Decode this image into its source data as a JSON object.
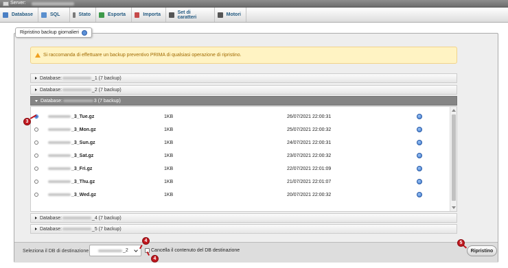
{
  "window": {
    "server_label": "Server:"
  },
  "navbar": {
    "tabs": [
      {
        "label": "Database",
        "icon": "database-icon",
        "color": "#4a7fc4"
      },
      {
        "label": "SQL",
        "icon": "sql-icon",
        "color": "#5a8fce"
      },
      {
        "label": "Stato",
        "icon": "status-icon",
        "color": "#7a7a7a"
      },
      {
        "label": "Esporta",
        "icon": "export-icon",
        "color": "#3e9a4a"
      },
      {
        "label": "Importa",
        "icon": "import-icon",
        "color": "#c64a4a"
      },
      {
        "label": "Set di caratteri",
        "icon": "charset-icon",
        "color": "#555555"
      },
      {
        "label": "Motori",
        "icon": "engines-icon",
        "color": "#555555"
      }
    ]
  },
  "panel": {
    "title": "Ripristino backup giornalieri",
    "notice": "Si raccomanda di effettuare un backup preventivo PRIMA di qualsiasi operazione di ripristino."
  },
  "databases": {
    "prefix": "Database:",
    "rows": [
      {
        "suffix": "_1 (7 backup)"
      },
      {
        "suffix": "_2 (7 backup)"
      },
      {
        "suffix": "3 (7 backup)"
      },
      {
        "suffix": "_4 (7 backup)"
      },
      {
        "suffix": "_5 (7 backup)"
      }
    ]
  },
  "files": [
    {
      "name_suffix": "_3_Tue.gz",
      "size": "1KB",
      "date": "26/07/2021 22:00:31",
      "selected": true
    },
    {
      "name_suffix": "_3_Mon.gz",
      "size": "1KB",
      "date": "25/07/2021 22:00:32",
      "selected": false
    },
    {
      "name_suffix": "_3_Sun.gz",
      "size": "1KB",
      "date": "24/07/2021 22:00:31",
      "selected": false
    },
    {
      "name_suffix": "_3_Sat.gz",
      "size": "1KB",
      "date": "23/07/2021 22:00:32",
      "selected": false
    },
    {
      "name_suffix": "_3_Fri.gz",
      "size": "1KB",
      "date": "22/07/2021 22:01:09",
      "selected": false
    },
    {
      "name_suffix": "_3_Thu.gz",
      "size": "1KB",
      "date": "21/07/2021 22:01:07",
      "selected": false
    },
    {
      "name_suffix": "_3_Wed.gz",
      "size": "1KB",
      "date": "20/07/2021 22:00:32",
      "selected": false
    }
  ],
  "footer": {
    "dest_label": "Seleziona il DB di destinazione",
    "select_value_suffix": "_2",
    "checkbox_label": "Cancella il contenuto del DB destinazione",
    "restore_button": "Ripristino"
  },
  "markers": [
    "3",
    "4",
    "4",
    "5"
  ]
}
